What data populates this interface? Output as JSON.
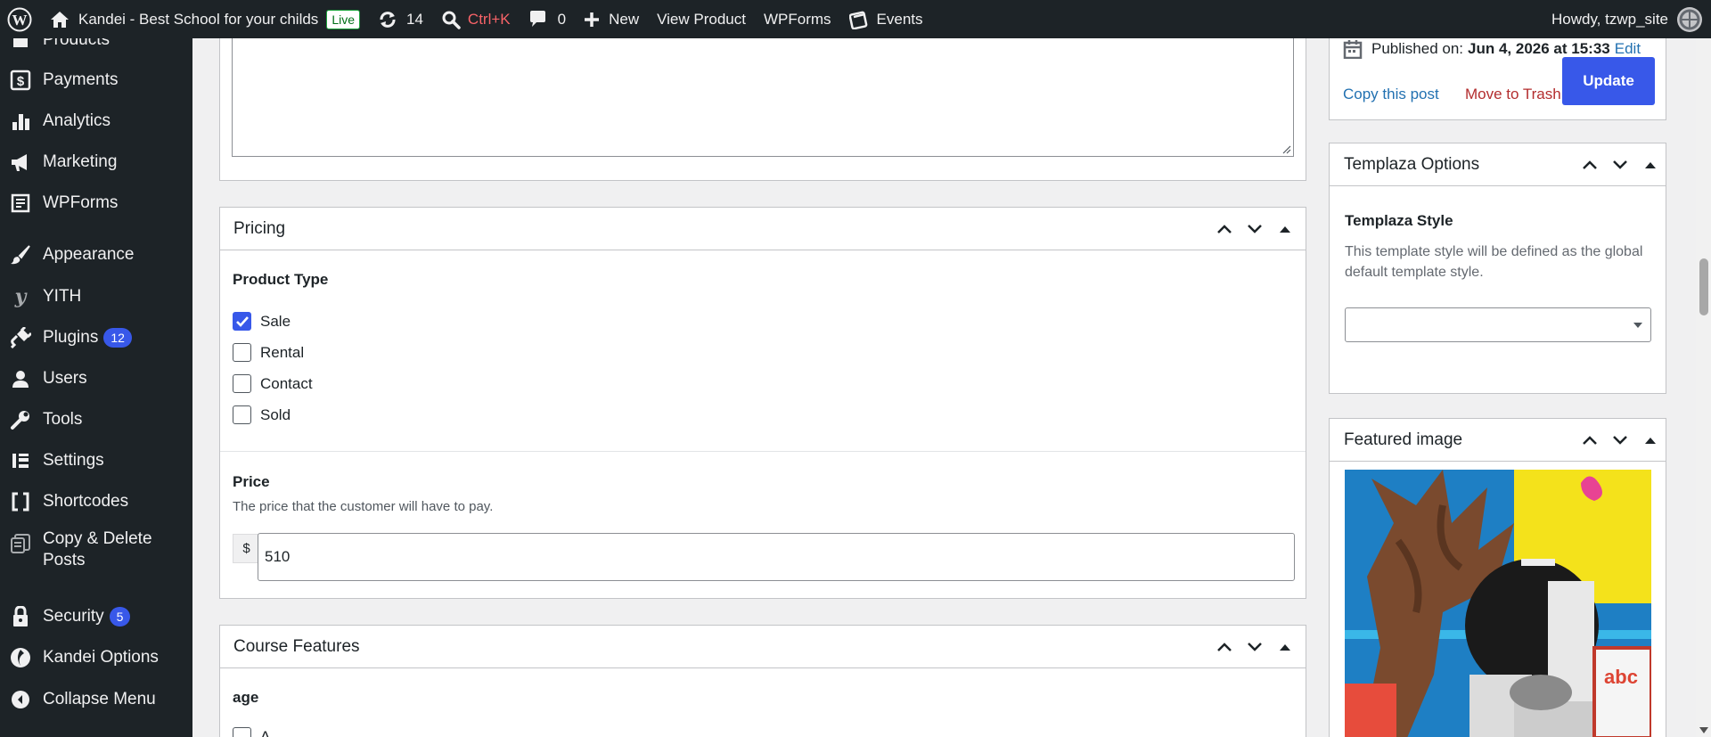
{
  "adminbar": {
    "site_name": "Kandei - Best School for your childs",
    "live_badge": "Live",
    "updates_count": "14",
    "search_shortcut": "Ctrl+K",
    "comments_count": "0",
    "new_label": "New",
    "view_product": "View Product",
    "wpforms": "WPForms",
    "events": "Events",
    "howdy": "Howdy, tzwp_site"
  },
  "sidebar": {
    "items": [
      {
        "label": "Products",
        "icon": "products-icon"
      },
      {
        "label": "Payments",
        "icon": "payments-icon"
      },
      {
        "label": "Analytics",
        "icon": "analytics-icon"
      },
      {
        "label": "Marketing",
        "icon": "megaphone-icon"
      },
      {
        "label": "WPForms",
        "icon": "wpforms-icon"
      },
      {
        "label": "Appearance",
        "icon": "paintbrush-icon"
      },
      {
        "label": "YITH",
        "icon": "yith-icon"
      },
      {
        "label": "Plugins",
        "icon": "plugin-icon",
        "badge": "12"
      },
      {
        "label": "Users",
        "icon": "users-icon"
      },
      {
        "label": "Tools",
        "icon": "wrench-icon"
      },
      {
        "label": "Settings",
        "icon": "settings-icon"
      },
      {
        "label": "Shortcodes",
        "icon": "shortcodes-icon"
      },
      {
        "label": "Copy & Delete",
        "label2": "Posts",
        "icon": "copy-delete-icon"
      },
      {
        "label": "Security",
        "icon": "lock-icon",
        "badge": "5"
      },
      {
        "label": "Kandei Options",
        "icon": "kandei-icon"
      },
      {
        "label": "Collapse Menu",
        "icon": "collapse-icon"
      }
    ]
  },
  "pricing": {
    "title": "Pricing",
    "product_type_label": "Product Type",
    "options": [
      {
        "label": "Sale",
        "checked": true
      },
      {
        "label": "Rental",
        "checked": false
      },
      {
        "label": "Contact",
        "checked": false
      },
      {
        "label": "Sold",
        "checked": false
      }
    ],
    "price_label": "Price",
    "price_desc": "The price that the customer will have to pay.",
    "currency": "$",
    "price_value": "510"
  },
  "course_features": {
    "title": "Course Features",
    "age_label": "age",
    "first_option": "A"
  },
  "publish": {
    "published_prefix": "Published on:",
    "published_date": "Jun 4, 2026 at 15:33",
    "edit_link": "Edit",
    "copy_post": "Copy this post",
    "move_trash": "Move to Trash",
    "update_button": "Update"
  },
  "templaza": {
    "title": "Templaza Options",
    "style_label": "Templaza Style",
    "style_desc": "This template style will be defined as the global default template style.",
    "select_value": ""
  },
  "featured": {
    "title": "Featured image"
  },
  "colors": {
    "adminbar_bg": "#1d2327",
    "accent": "#3858e9",
    "link": "#2271b1",
    "danger": "#b32d2e"
  }
}
